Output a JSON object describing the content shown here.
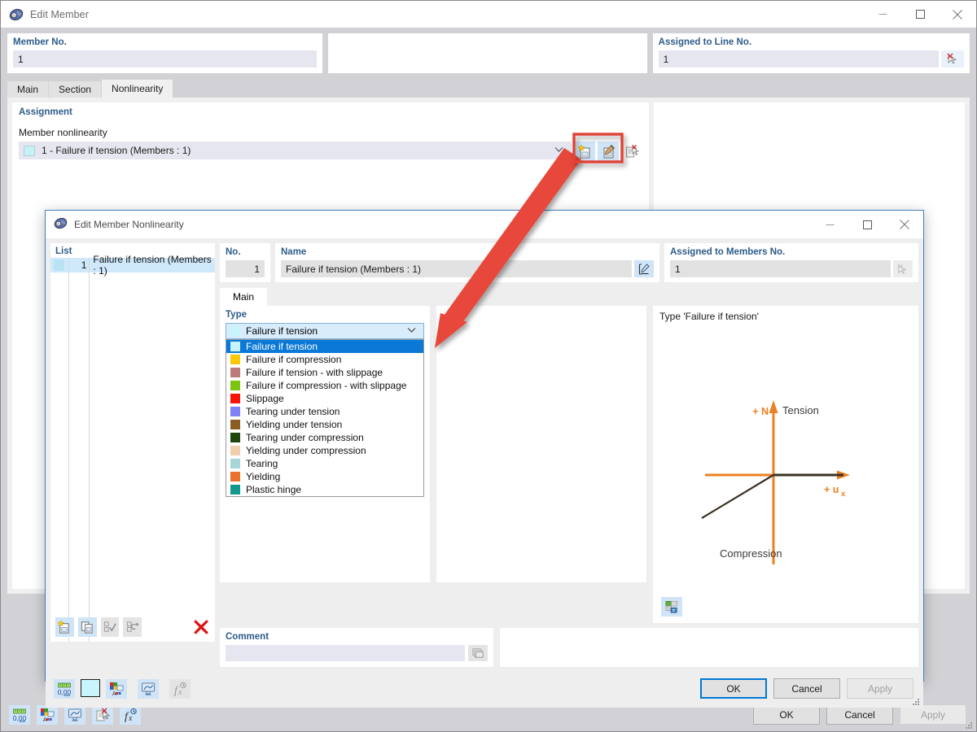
{
  "outer": {
    "title": "Edit Member",
    "icon": "member-icon",
    "window_controls": {
      "minimize": "minimize-icon",
      "maximize": "maximize-icon",
      "close": "close-icon"
    },
    "fields": {
      "member_no_label": "Member No.",
      "member_no_value": "1",
      "assigned_line_label": "Assigned to Line No.",
      "assigned_line_value": "1"
    },
    "tabs": [
      {
        "label": "Main",
        "active": false
      },
      {
        "label": "Section",
        "active": false
      },
      {
        "label": "Nonlinearity",
        "active": true
      }
    ],
    "assignment": {
      "group_title": "Assignment",
      "field_label": "Member nonlinearity",
      "selected_value": "1 - Failure if tension (Members : 1)",
      "selected_color": "#c8f0f7",
      "buttons": [
        {
          "name": "new-nonlinearity-button",
          "icon": "new-page-star-icon"
        },
        {
          "name": "edit-nonlinearity-button",
          "icon": "edit-page-pencil-icon"
        },
        {
          "name": "delete-nonlinearity-button",
          "icon": "delete-page-icon",
          "disabled": true
        }
      ]
    },
    "toolbar": [
      {
        "name": "units-button",
        "icon": "units-0-00-icon"
      },
      {
        "name": "colors-button",
        "icon": "color-palette-icon"
      },
      {
        "name": "display-button",
        "icon": "display-monitor-icon"
      },
      {
        "name": "deselect-button",
        "icon": "deselect-pointer-icon"
      },
      {
        "name": "formula-button",
        "icon": "formula-fx-icon"
      }
    ],
    "buttons": {
      "ok": "OK",
      "cancel": "Cancel",
      "apply": "Apply"
    }
  },
  "inner": {
    "title": "Edit Member Nonlinearity",
    "icon": "nonlinearity-icon",
    "window_controls": {
      "minimize": "minimize-icon",
      "maximize": "maximize-icon",
      "close": "close-icon"
    },
    "list": {
      "header": "List",
      "rows": [
        {
          "no": "1",
          "name": "Failure if tension (Members : 1)",
          "color": "#b9e3f5",
          "selected": true
        }
      ],
      "toolbar": [
        {
          "name": "new-item-button",
          "icon": "new-page-star-icon"
        },
        {
          "name": "copy-item-button",
          "icon": "copy-pages-icon"
        },
        {
          "name": "select-all-button",
          "icon": "check-all-icon",
          "disabled": true
        },
        {
          "name": "invert-selection-button",
          "icon": "invert-check-icon",
          "disabled": true
        },
        {
          "name": "delete-item-button",
          "icon": "red-x-icon"
        }
      ]
    },
    "no_field": {
      "label": "No.",
      "value": "1"
    },
    "name_field": {
      "label": "Name",
      "value": "Failure if tension (Members : 1)",
      "edit_button": "edit-name-button"
    },
    "assigned_field": {
      "label": "Assigned to Members No.",
      "value": "1",
      "pick_button": "pick-members-button"
    },
    "tabs": [
      {
        "label": "Main",
        "active": true
      }
    ],
    "type_section": {
      "label": "Type",
      "selected": "Failure if tension",
      "selected_color": "#c8f0f7",
      "options": [
        {
          "label": "Failure if tension",
          "color": "#c8f5fb",
          "selected": true
        },
        {
          "label": "Failure if compression",
          "color": "#fcc80a"
        },
        {
          "label": "Failure if tension - with slippage",
          "color": "#bd7a7a"
        },
        {
          "label": "Failure if compression - with slippage",
          "color": "#7cc412"
        },
        {
          "label": "Slippage",
          "color": "#fa1408"
        },
        {
          "label": "Tearing under tension",
          "color": "#7f80f5"
        },
        {
          "label": "Yielding under tension",
          "color": "#8c5c22"
        },
        {
          "label": "Tearing under compression",
          "color": "#20460c"
        },
        {
          "label": "Yielding under compression",
          "color": "#f0cfae"
        },
        {
          "label": "Tearing",
          "color": "#a6d6d6"
        },
        {
          "label": "Yielding",
          "color": "#e8712c"
        },
        {
          "label": "Plastic hinge",
          "color": "#11998f"
        }
      ]
    },
    "comment": {
      "label": "Comment",
      "value": "",
      "copy_button": "copy-comment-button"
    },
    "diagram": {
      "title": "Type 'Failure if tension'",
      "axis_color": "#ec8022",
      "curve_color": "#3b3124",
      "labels": {
        "n_axis": "+ N",
        "tension": "Tension",
        "compression": "Compression",
        "u_axis": "+ u",
        "u_axis_sub": "x"
      },
      "info_button": "diagram-settings-icon"
    },
    "toolbar": [
      {
        "name": "units-button",
        "icon": "units-0-00-icon"
      },
      {
        "name": "color-swatch-button",
        "icon": "color-swatch-icon",
        "color": "#c8f5fb"
      },
      {
        "name": "colors-button",
        "icon": "color-palette-icon"
      },
      {
        "name": "display-button",
        "icon": "display-monitor-icon"
      },
      {
        "name": "formula-button",
        "icon": "formula-fx-icon",
        "disabled": true
      }
    ],
    "buttons": {
      "ok": "OK",
      "cancel": "Cancel",
      "apply": "Apply"
    }
  },
  "annotation": {
    "highlight_color": "#e04235",
    "arrow_color": "#e04235",
    "target": "new-and-edit-nonlinearity-buttons"
  }
}
